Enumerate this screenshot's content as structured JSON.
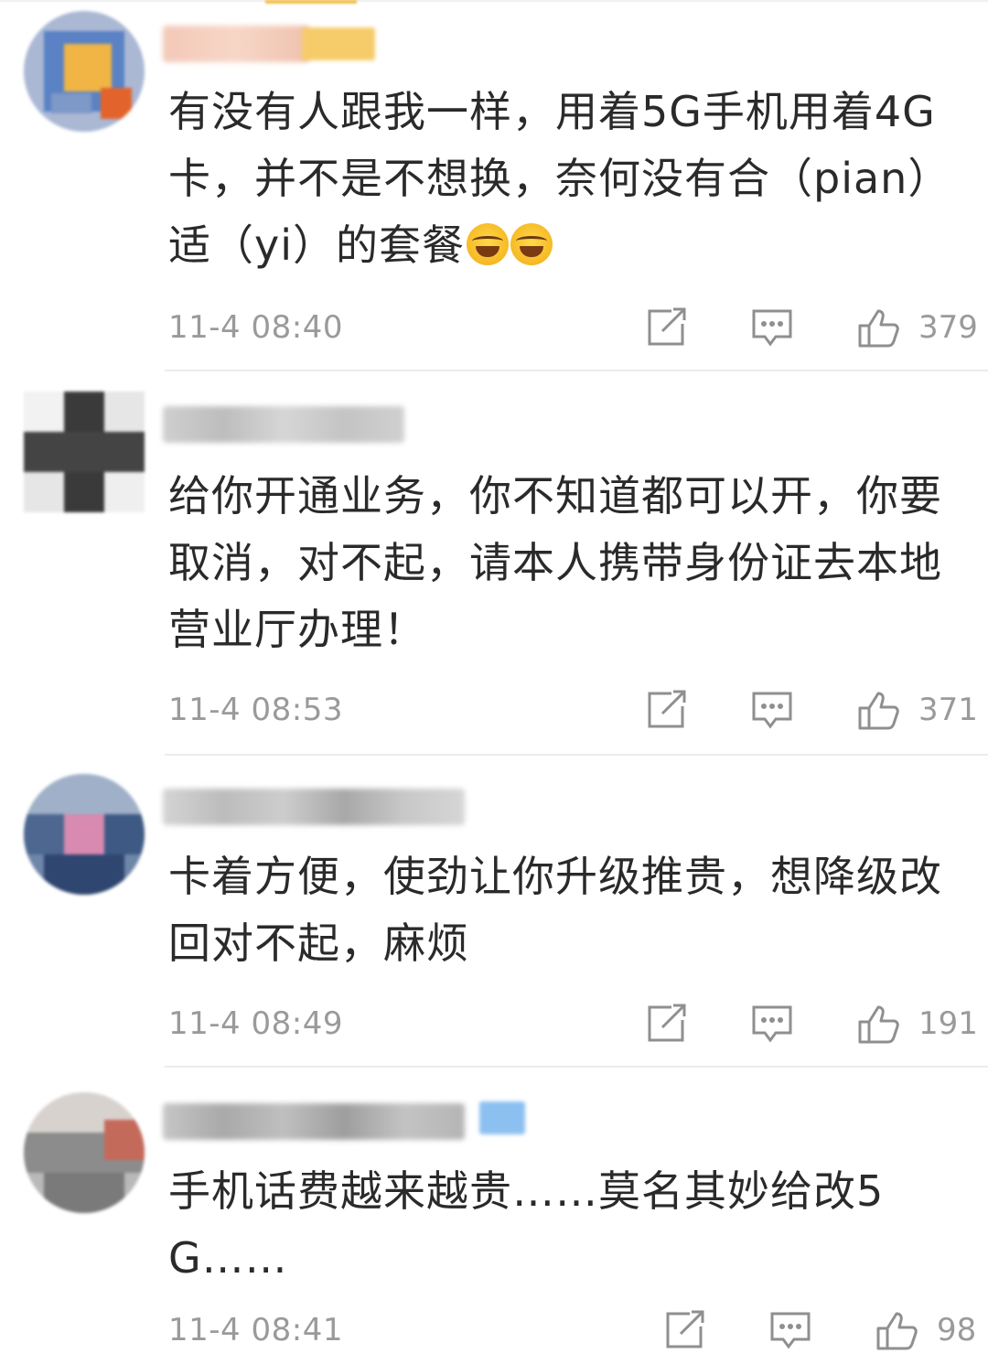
{
  "comments": [
    {
      "text": "有没有人跟我一样，用着5G手机用着4G卡，并不是不想换，奈何没有合（pian）适（yi）的套餐",
      "emojis": [
        "crying-laughing-emoji",
        "crying-laughing-emoji"
      ],
      "time": "11-4 08:40",
      "likes": "379"
    },
    {
      "text": "给你开通业务，你不知道都可以开，你要取消，对不起，请本人携带身份证去本地营业厅办理！",
      "emojis": [],
      "time": "11-4 08:53",
      "likes": "371"
    },
    {
      "text": "卡着方便，使劲让你升级推贵，想降级改回对不起，麻烦",
      "emojis": [],
      "time": "11-4 08:49",
      "likes": "191"
    },
    {
      "text": "手机话费越来越贵……莫名其妙给改5G……",
      "emojis": [],
      "time": "11-4 08:41",
      "likes": "98"
    }
  ],
  "icons": {
    "repost": "share-square-icon",
    "comment": "comment-bubble-icon",
    "like": "thumbs-up-icon"
  },
  "colors": {
    "text": "#2a2a2a",
    "meta": "#9a9a9a",
    "divider": "#ececec"
  }
}
